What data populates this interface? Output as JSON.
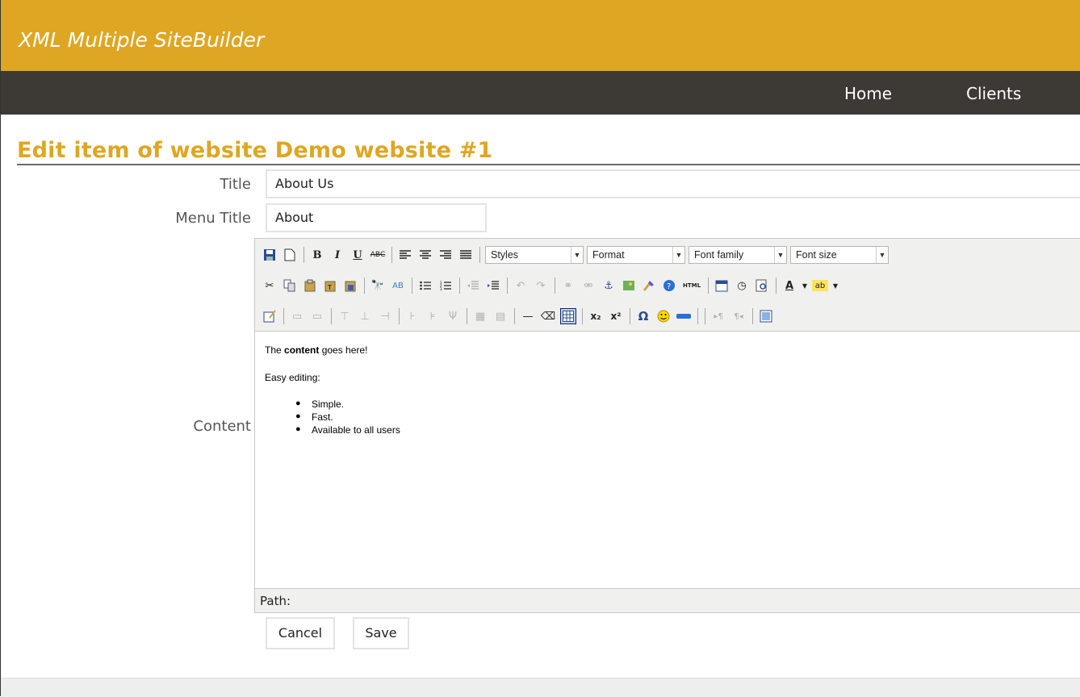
{
  "app": {
    "title": "XML Multiple SiteBuilder"
  },
  "nav": {
    "home": "Home",
    "clients": "Clients"
  },
  "page": {
    "heading": "Edit item of website Demo website #1"
  },
  "form": {
    "title_label": "Title",
    "title_value": "About Us",
    "menu_title_label": "Menu Title",
    "menu_title_value": "About",
    "content_label": "Content"
  },
  "editor": {
    "selects": {
      "styles": "Styles",
      "format": "Format",
      "font_family": "Font family",
      "font_size": "Font size"
    },
    "content": {
      "p1_bold": "content",
      "p1_prefix": "The ",
      "p1_suffix": " goes here!",
      "p2": "Easy editing:",
      "list": [
        "Simple.",
        "Fast.",
        "Available to all users"
      ]
    },
    "path_label": "Path:"
  },
  "buttons": {
    "cancel": "Cancel",
    "save": "Save"
  },
  "colors": {
    "accent": "#dea623",
    "navbar": "#3d3935"
  }
}
